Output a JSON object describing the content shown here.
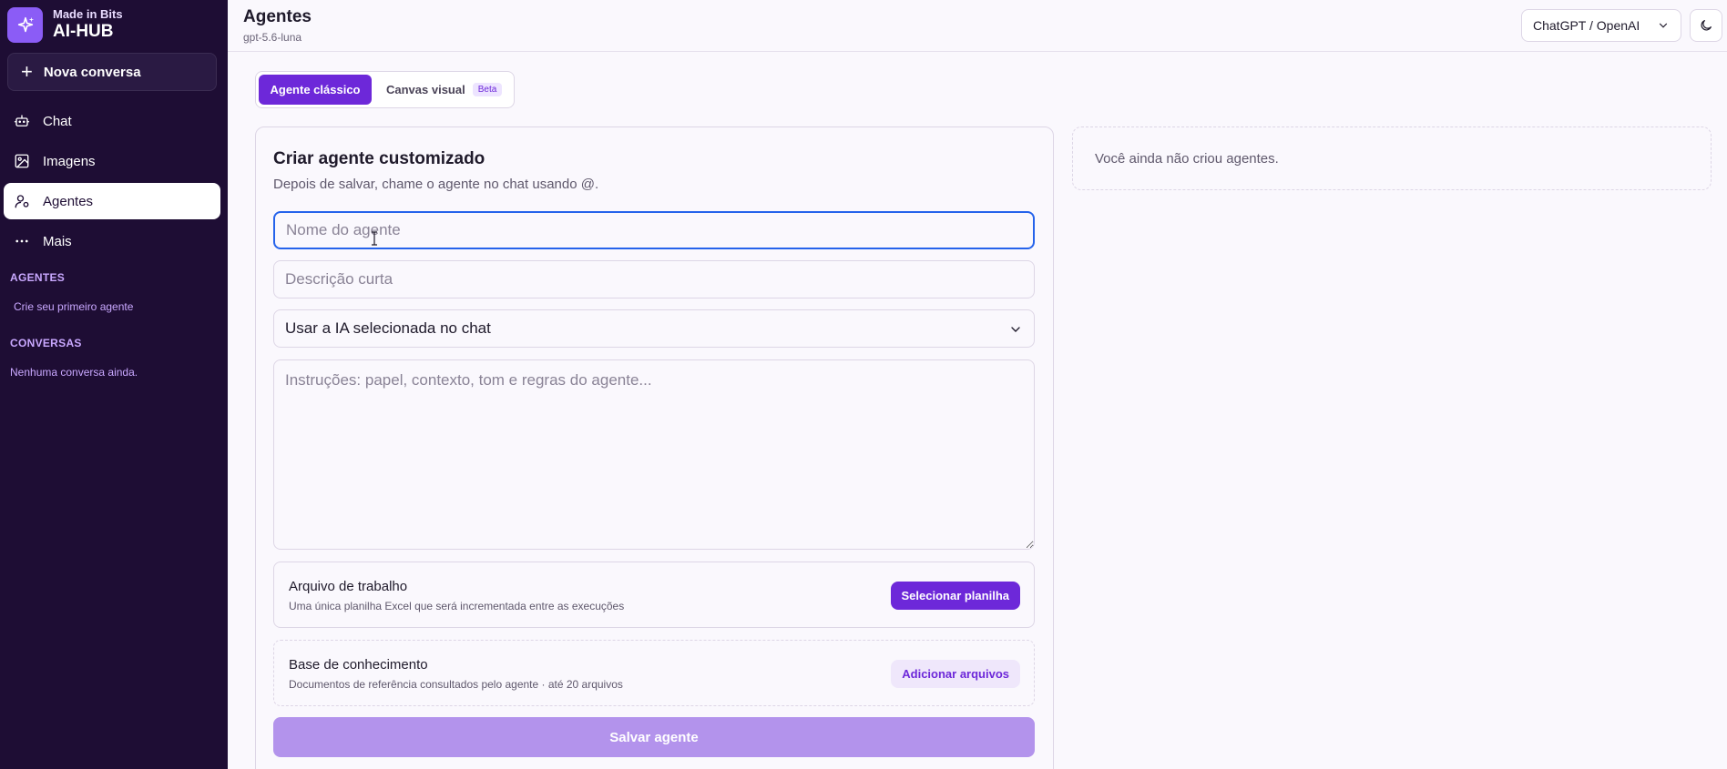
{
  "sidebar": {
    "brand_sub": "Made in Bits",
    "brand_title": "AI-HUB",
    "new_chat": "Nova conversa",
    "nav": [
      {
        "label": "Chat",
        "icon": "robot-icon"
      },
      {
        "label": "Imagens",
        "icon": "image-icon"
      },
      {
        "label": "Agentes",
        "icon": "user-icon",
        "active": true
      },
      {
        "label": "Mais",
        "icon": "more-icon"
      }
    ],
    "agents_section": "AGENTES",
    "agents_link": "Crie seu primeiro agente",
    "conversations_section": "CONVERSAS",
    "conversations_empty": "Nenhuma conversa ainda."
  },
  "header": {
    "title": "Agentes",
    "subtitle": "gpt-5.6-luna",
    "provider": "ChatGPT / OpenAI"
  },
  "mode": {
    "classic": "Agente clássico",
    "canvas": "Canvas visual",
    "beta": "Beta"
  },
  "form": {
    "title": "Criar agente customizado",
    "subtitle": "Depois de salvar, chame o agente no chat usando @.",
    "name_placeholder": "Nome do agente",
    "name_value": "",
    "description_placeholder": "Descrição curta",
    "description_value": "",
    "model_select": "Usar a IA selecionada no chat",
    "instructions_placeholder": "Instruções: papel, contexto, tom e regras do agente...",
    "work_file": {
      "title": "Arquivo de trabalho",
      "desc": "Uma única planilha Excel que será incrementada entre as execuções",
      "button": "Selecionar planilha"
    },
    "knowledge": {
      "title": "Base de conhecimento",
      "desc": "Documentos de referência consultados pelo agente · até 20 arquivos",
      "button": "Adicionar arquivos"
    },
    "save": "Salvar agente"
  },
  "agents_list": {
    "empty": "Você ainda não criou agentes."
  },
  "colors": {
    "sidebar_bg": "#1e0d34",
    "accent": "#6d28d9",
    "accent_disabled": "#b393ec",
    "focus": "#2563eb"
  }
}
